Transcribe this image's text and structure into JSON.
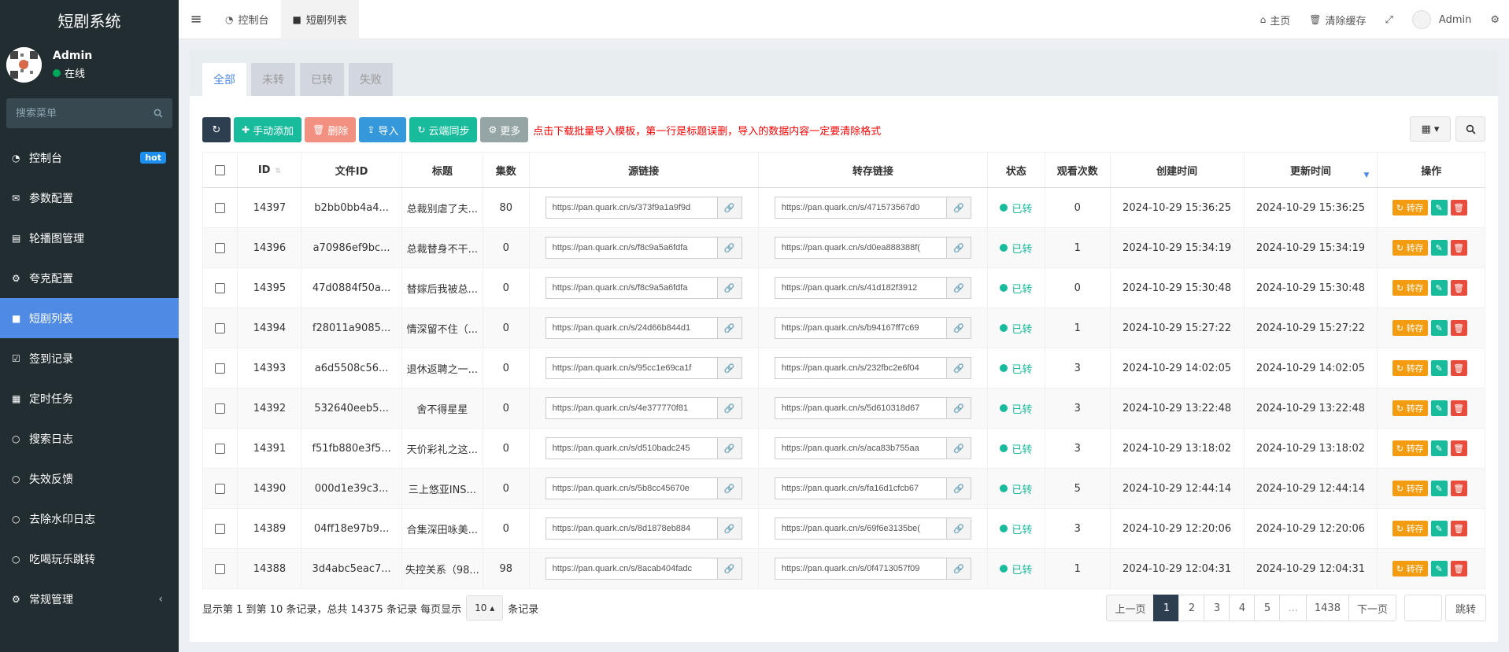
{
  "brand": "短剧系统",
  "user": {
    "name": "Admin",
    "status": "在线"
  },
  "search": {
    "placeholder": "搜索菜单"
  },
  "menu": [
    {
      "icon": "dashboard-icon",
      "glyph": "◔",
      "label": "控制台",
      "badge": "hot"
    },
    {
      "icon": "bullhorn-icon",
      "glyph": "✉",
      "label": "参数配置"
    },
    {
      "icon": "chart-icon",
      "glyph": "▤",
      "label": "轮播图管理"
    },
    {
      "icon": "gear-icon",
      "glyph": "⚙",
      "label": "夸克配置"
    },
    {
      "icon": "video-icon",
      "glyph": "■",
      "label": "短剧列表",
      "active": true
    },
    {
      "icon": "calendar-check-icon",
      "glyph": "☑",
      "label": "签到记录"
    },
    {
      "icon": "file-icon",
      "glyph": "▦",
      "label": "定时任务"
    },
    {
      "icon": "circle-icon",
      "glyph": "○",
      "label": "搜索日志"
    },
    {
      "icon": "circle-icon",
      "glyph": "○",
      "label": "失效反馈"
    },
    {
      "icon": "circle-icon",
      "glyph": "○",
      "label": "去除水印日志"
    },
    {
      "icon": "circle-icon",
      "glyph": "○",
      "label": "吃喝玩乐跳转"
    },
    {
      "icon": "cogs-icon",
      "glyph": "⚙",
      "label": "常规管理",
      "chevron": "‹"
    }
  ],
  "topbar": {
    "tabs": [
      {
        "label": "控制台",
        "glyph": "◔"
      },
      {
        "label": "短剧列表",
        "glyph": "■"
      }
    ],
    "right": {
      "home": "主页",
      "clear_cache": "清除缓存",
      "user": "Admin"
    }
  },
  "panel_tabs": [
    "全部",
    "未转",
    "已转",
    "失败"
  ],
  "toolbar": {
    "add": "手动添加",
    "delete": "删除",
    "import": "导入",
    "sync": "云端同步",
    "more": "更多",
    "tip": "点击下载批量导入模板，第一行是标题误删，导入的数据内容一定要清除格式"
  },
  "table": {
    "headers": {
      "id": "ID",
      "file_id": "文件ID",
      "title": "标题",
      "episodes": "集数",
      "source": "源链接",
      "transfer": "转存链接",
      "status": "状态",
      "views": "观看次数",
      "created": "创建时间",
      "updated": "更新时间",
      "ops": "操作"
    },
    "op_transfer": "转存",
    "rows": [
      {
        "id": "14397",
        "file_id": "b2bb0bb4a4...",
        "title": "总裁别虐了夫...",
        "episodes": "80",
        "source": "https://pan.quark.cn/s/373f9a1a9f9d",
        "transfer": "https://pan.quark.cn/s/471573567d0",
        "status": "已转",
        "views": "0",
        "created": "2024-10-29 15:36:25",
        "updated": "2024-10-29 15:36:25"
      },
      {
        "id": "14396",
        "file_id": "a70986ef9bc...",
        "title": "总裁替身不干...",
        "episodes": "0",
        "source": "https://pan.quark.cn/s/f8c9a5a6fdfa",
        "transfer": "https://pan.quark.cn/s/d0ea888388f(",
        "status": "已转",
        "views": "1",
        "created": "2024-10-29 15:34:19",
        "updated": "2024-10-29 15:34:19"
      },
      {
        "id": "14395",
        "file_id": "47d0884f50a...",
        "title": "替嫁后我被总...",
        "episodes": "0",
        "source": "https://pan.quark.cn/s/f8c9a5a6fdfa",
        "transfer": "https://pan.quark.cn/s/41d182f3912",
        "status": "已转",
        "views": "0",
        "created": "2024-10-29 15:30:48",
        "updated": "2024-10-29 15:30:48"
      },
      {
        "id": "14394",
        "file_id": "f28011a9085...",
        "title": "情深留不住（...",
        "episodes": "0",
        "source": "https://pan.quark.cn/s/24d66b844d1",
        "transfer": "https://pan.quark.cn/s/b94167ff7c69",
        "status": "已转",
        "views": "1",
        "created": "2024-10-29 15:27:22",
        "updated": "2024-10-29 15:27:22"
      },
      {
        "id": "14393",
        "file_id": "a6d5508c56...",
        "title": "退休返聘之一...",
        "episodes": "0",
        "source": "https://pan.quark.cn/s/95cc1e69ca1f",
        "transfer": "https://pan.quark.cn/s/232fbc2e6f04",
        "status": "已转",
        "views": "3",
        "created": "2024-10-29 14:02:05",
        "updated": "2024-10-29 14:02:05"
      },
      {
        "id": "14392",
        "file_id": "532640eeb5...",
        "title": "舍不得星星",
        "episodes": "0",
        "source": "https://pan.quark.cn/s/4e377770f81",
        "transfer": "https://pan.quark.cn/s/5d610318d67",
        "status": "已转",
        "views": "3",
        "created": "2024-10-29 13:22:48",
        "updated": "2024-10-29 13:22:48"
      },
      {
        "id": "14391",
        "file_id": "f51fb880e3f5...",
        "title": "天价彩礼之这...",
        "episodes": "0",
        "source": "https://pan.quark.cn/s/d510badc245",
        "transfer": "https://pan.quark.cn/s/aca83b755aa",
        "status": "已转",
        "views": "3",
        "created": "2024-10-29 13:18:02",
        "updated": "2024-10-29 13:18:02"
      },
      {
        "id": "14390",
        "file_id": "000d1e39c3...",
        "title": "三上悠亚INS...",
        "episodes": "0",
        "source": "https://pan.quark.cn/s/5b8cc45670e",
        "transfer": "https://pan.quark.cn/s/fa16d1cfcb67",
        "status": "已转",
        "views": "5",
        "created": "2024-10-29 12:44:14",
        "updated": "2024-10-29 12:44:14"
      },
      {
        "id": "14389",
        "file_id": "04ff18e97b9...",
        "title": "合集深田咏美...",
        "episodes": "0",
        "source": "https://pan.quark.cn/s/8d1878eb884",
        "transfer": "https://pan.quark.cn/s/69f6e3135be(",
        "status": "已转",
        "views": "3",
        "created": "2024-10-29 12:20:06",
        "updated": "2024-10-29 12:20:06"
      },
      {
        "id": "14388",
        "file_id": "3d4abc5eac7...",
        "title": "失控关系（98...",
        "episodes": "98",
        "source": "https://pan.quark.cn/s/8acab404fadc",
        "transfer": "https://pan.quark.cn/s/0f4713057f09",
        "status": "已转",
        "views": "1",
        "created": "2024-10-29 12:04:31",
        "updated": "2024-10-29 12:04:31"
      }
    ]
  },
  "footer": {
    "info_prefix": "显示第 1 到第 10 条记录，总共 14375 条记录 每页显示",
    "page_size": "10",
    "info_suffix": "条记录"
  },
  "pagination": {
    "prev": "上一页",
    "pages": [
      "1",
      "2",
      "3",
      "4",
      "5",
      "...",
      "1438"
    ],
    "current": "1",
    "next": "下一页",
    "jump": "跳转"
  },
  "colors": {
    "sidebar": "#222d32",
    "accent": "#4f8be5",
    "success": "#18bc9c",
    "danger": "#e74c3c",
    "warning": "#f39c12"
  }
}
